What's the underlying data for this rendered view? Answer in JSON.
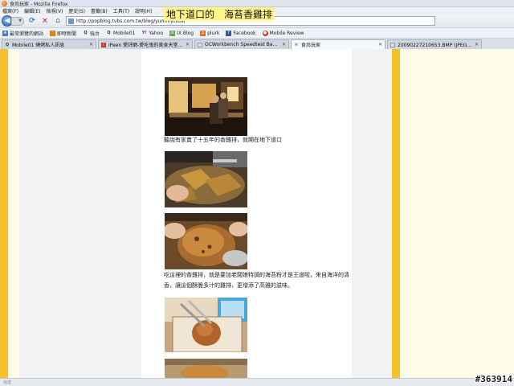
{
  "window": {
    "title": "食尚玩家 - Mozilla Firefox"
  },
  "menu": [
    "檔案(F)",
    "編輯(E)",
    "檢視(V)",
    "歷史(S)",
    "書籤(B)",
    "工具(T)",
    "說明(H)"
  ],
  "nav": {
    "url": "http://popblog.tvbs.com.tw/blog/yummytvbs/"
  },
  "bookmarks": [
    {
      "label": "最常瀏覽的網站",
      "icon": "star-icon",
      "color": "#4a7fc1"
    },
    {
      "label": "即時新聞",
      "icon": "rss-icon",
      "color": "#e07b1e"
    },
    {
      "label": "強台",
      "icon": "q-icon",
      "color": "#333333"
    },
    {
      "label": "Mobile01",
      "icon": "q-icon",
      "color": "#333333"
    },
    {
      "label": "Yahoo",
      "icon": "yahoo-icon",
      "color": "#7b1fa2"
    },
    {
      "label": "IX Blog",
      "icon": "ix-icon",
      "color": "#6aa84f"
    },
    {
      "label": "plurk",
      "icon": "plurk-icon",
      "color": "#e06f1e"
    },
    {
      "label": "Facebook",
      "icon": "facebook-icon",
      "color": "#3b5998"
    },
    {
      "label": "Mobile Review",
      "icon": "mobile-review-icon",
      "color": "#c0392b"
    }
  ],
  "tabs": [
    {
      "label": "Mobile01 燒烤私人訊息",
      "icon": "q-icon",
      "color": "#333333",
      "active": false
    },
    {
      "label": "iPeen 愛評網-愛吃鬼的美食天堂-餐...",
      "icon": "ipeen-icon",
      "color": "#c0392b",
      "active": false
    },
    {
      "label": "OCWorkbench Speedtest Bandwi...",
      "icon": "page-icon",
      "color": "#888888",
      "active": false
    },
    {
      "label": "食尚玩家",
      "icon": "loading-icon",
      "color": "#888888",
      "active": true
    },
    {
      "label": "20090227210653.BMP (JPEG 圖片...",
      "icon": "image-icon",
      "color": "#888888",
      "active": false
    }
  ],
  "post": {
    "title": "地下道口的　海苔香雞排",
    "paragraph1": "聽說有家賣了十五年的香雞排，就開在地下道口",
    "paragraph2_line1": "吃這裡的香雞排，就是要加老闆娘特調的海苔粉才是王道啦，來自海洋的清",
    "paragraph2_line2": "香，讓這個酥脆多汁的雞排，更增添了高雅的滋味。"
  },
  "statusbar": {
    "text": "完成"
  },
  "watermark": "#363914"
}
